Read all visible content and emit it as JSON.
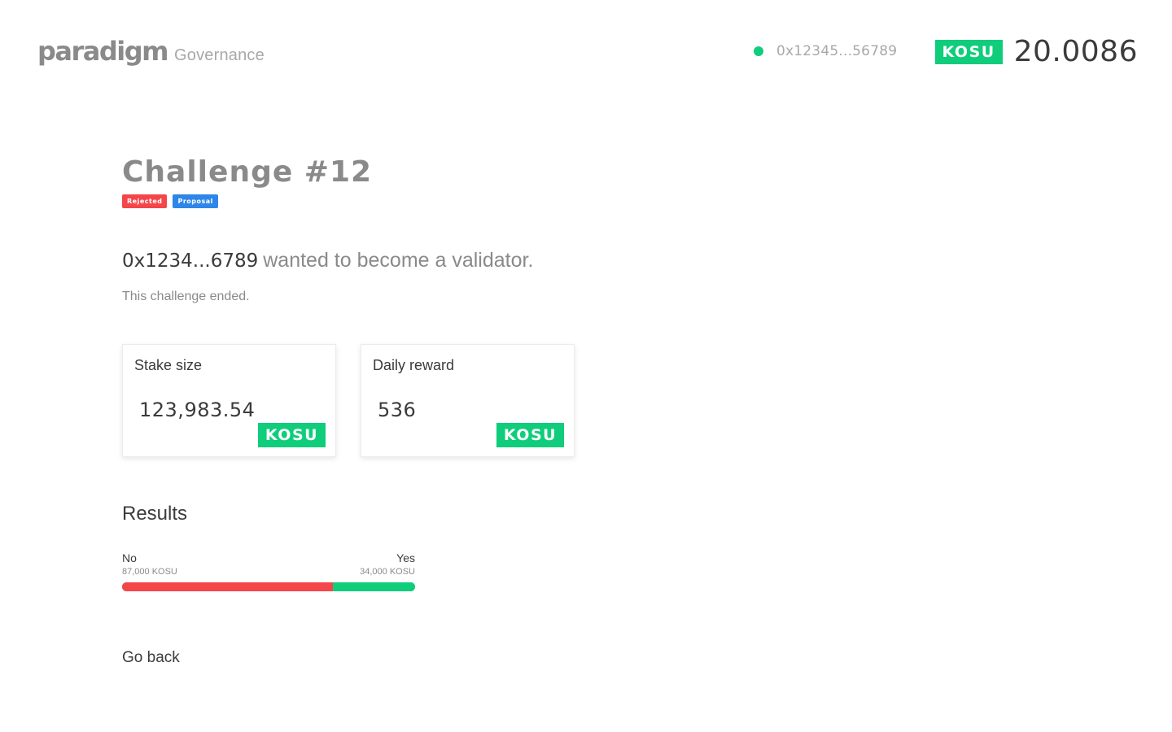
{
  "header": {
    "logo_text": "paradigm",
    "logo_subtitle": "Governance",
    "account_address": "0x12345...56789",
    "balance_unit": "KOSU",
    "balance_value": "20.0086",
    "colors": {
      "status": "#0fcd7b"
    }
  },
  "challenge": {
    "title": "Challenge #12",
    "tags": [
      {
        "label": "Rejected",
        "color": "#f4464a"
      },
      {
        "label": "Proposal",
        "color": "#2d86e8"
      }
    ],
    "summary_address": "0x1234...6789",
    "summary_text": "wanted to become a validator.",
    "status_text": "This challenge ended."
  },
  "cards": [
    {
      "label": "Stake size",
      "value": "123,983.54",
      "unit": "KOSU"
    },
    {
      "label": "Daily reward",
      "value": "536",
      "unit": "KOSU"
    }
  ],
  "results": {
    "title": "Results",
    "no": {
      "label": "No",
      "amount": "87,000 KOSU",
      "value": 87000,
      "color": "#f4464a"
    },
    "yes": {
      "label": "Yes",
      "amount": "34,000 KOSU",
      "value": 34000,
      "color": "#0fcd7b"
    }
  },
  "nav": {
    "go_back": "Go back"
  }
}
